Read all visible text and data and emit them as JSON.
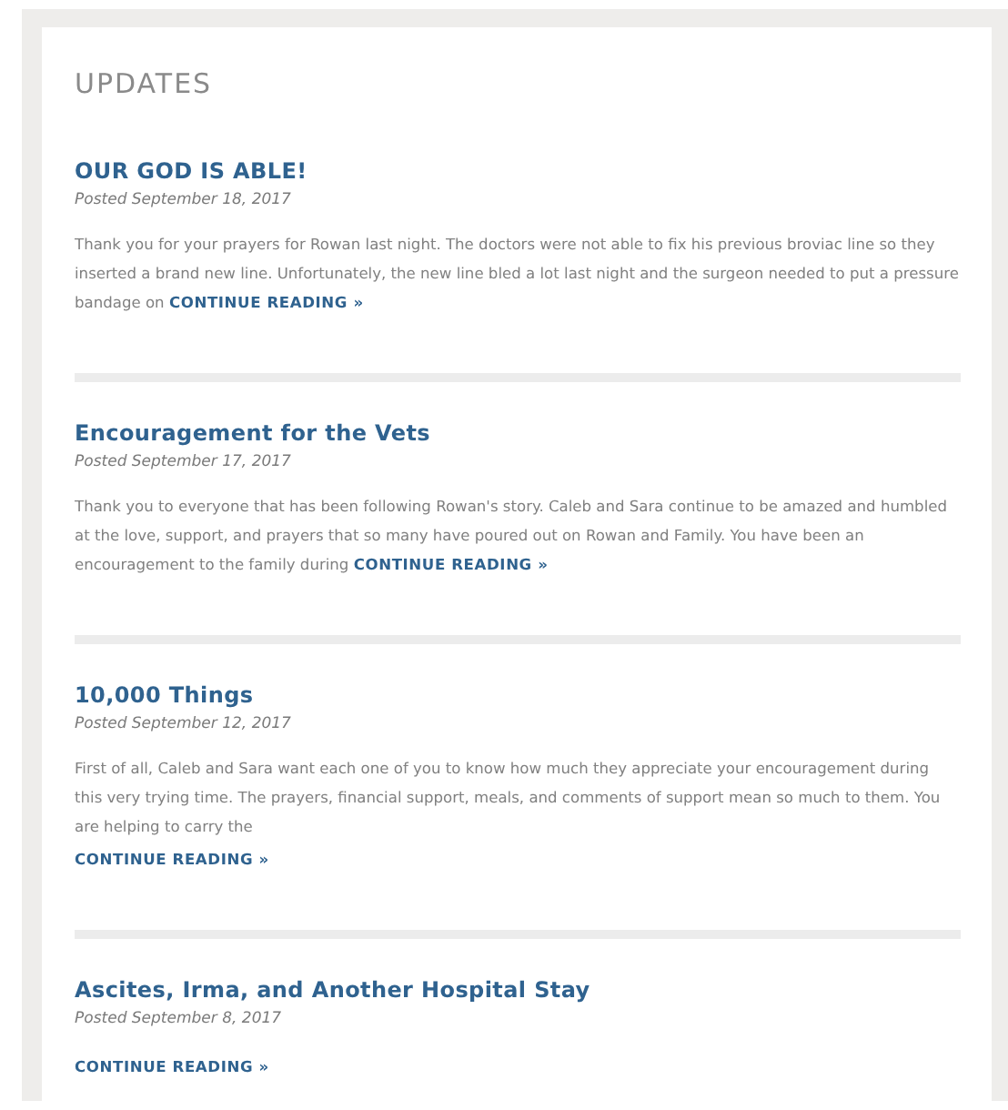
{
  "heading": "UPDATES",
  "posts": [
    {
      "title": "OUR GOD IS ABLE!",
      "date": "Posted September 18, 2017",
      "excerpt": "Thank you for your prayers for Rowan last night.  The doctors were not able to fix his previous broviac line so they inserted a brand new line.  Unfortunately, the new line bled a lot last night and the surgeon needed to put a pressure bandage on",
      "more": "CONTINUE READING »",
      "more_on_new_line": false
    },
    {
      "title": "Encouragement for the Vets",
      "date": "Posted September 17, 2017",
      "excerpt": "Thank you to everyone that has been following Rowan's story. Caleb and Sara continue to be amazed and humbled at the love, support, and prayers that so many have poured out on Rowan and Family. You have been an encouragement to the family during",
      "more": "CONTINUE READING »",
      "more_on_new_line": false
    },
    {
      "title": "10,000 Things",
      "date": "Posted September 12, 2017",
      "excerpt": "First of all, Caleb and Sara want each one of you to know how much they appreciate your encouragement during this very trying time.  The prayers, financial support, meals, and comments of support mean so much to them.  You are helping to carry the",
      "more": "CONTINUE READING »",
      "more_on_new_line": true
    },
    {
      "title": "Ascites, Irma, and Another Hospital Stay",
      "date": "Posted September 8, 2017",
      "more": "CONTINUE READING »",
      "more_on_new_line": true
    }
  ]
}
